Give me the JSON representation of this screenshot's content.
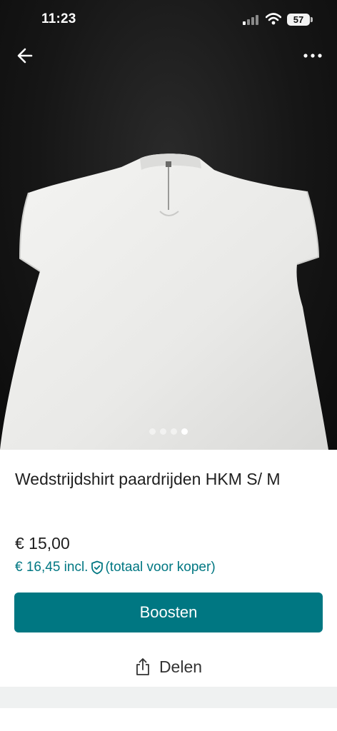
{
  "status_bar": {
    "time": "11:23",
    "battery": "57"
  },
  "navigation": {
    "back_icon": "arrow-left-icon",
    "more_icon": "more-horizontal-icon"
  },
  "gallery": {
    "image_count": 4,
    "active_index": 3
  },
  "item": {
    "title": "Wedstrijdshirt paardrijden HKM S/ M",
    "price": "€ 15,00",
    "price_incl": "€ 16,45 incl.",
    "buyer_note": "(totaal voor koper)"
  },
  "actions": {
    "boost_label": "Boosten",
    "share_label": "Delen"
  },
  "colors": {
    "accent": "#007782",
    "photo_background": "#141414",
    "text": "#1f1f1f"
  }
}
